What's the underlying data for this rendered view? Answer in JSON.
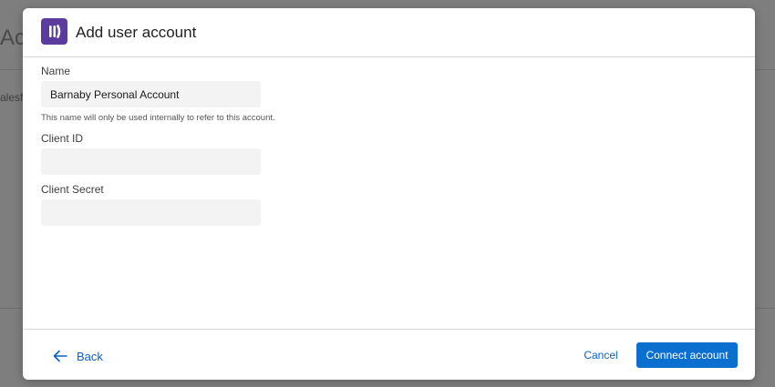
{
  "background": {
    "title_fragment": "Act",
    "item_fragment": "alesfo"
  },
  "modal": {
    "title": "Add user account",
    "logo_icon": "app-logo-icon",
    "accent_color": "#5b3c9e"
  },
  "form": {
    "name": {
      "label": "Name",
      "value": "Barnaby Personal Account",
      "help": "This name will only be used internally to refer to this account."
    },
    "client_id": {
      "label": "Client ID",
      "value": ""
    },
    "client_secret": {
      "label": "Client Secret",
      "value": ""
    }
  },
  "footer": {
    "back_label": "Back",
    "back_icon": "arrow-left-icon",
    "cancel_label": "Cancel",
    "connect_label": "Connect account",
    "primary_color": "#0b6fd0"
  }
}
